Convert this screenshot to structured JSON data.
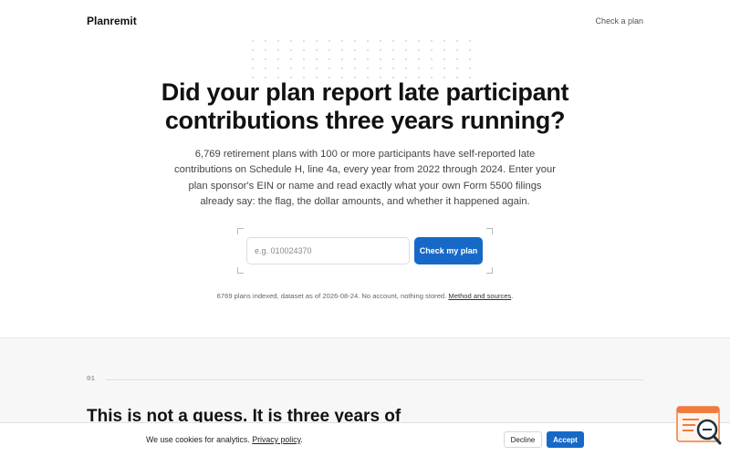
{
  "header": {
    "brand": "Planremit",
    "nav_link": "Check a plan"
  },
  "hero": {
    "title_line1": "Did your plan report late participant",
    "title_line2": "contributions three years running?",
    "description": "6,769 retirement plans with 100 or more participants have self-reported late contributions on Schedule H, line 4a, every year from 2022 through 2024. Enter your plan sponsor's EIN or name and read exactly what your own Form 5500 filings already say: the flag, the dollar amounts, and whether it happened again."
  },
  "search": {
    "placeholder": "e.g. 010024370",
    "value": "",
    "button_label": "Check my plan"
  },
  "index_note": {
    "text": "6769 plans indexed, dataset as of 2026-08-24. No account, nothing stored.",
    "link": "Method and sources",
    "suffix": "."
  },
  "section": {
    "number": "01",
    "heading": "This is not a guess. It is three years of"
  },
  "cookie": {
    "text": "We use cookies for analytics.",
    "link": "Privacy policy",
    "suffix": ".",
    "decline_label": "Decline",
    "accept_label": "Accept"
  },
  "widget": {
    "icon": "search-chat-icon"
  },
  "colors": {
    "accent": "#1769c7",
    "widget": "#f07b3f"
  }
}
